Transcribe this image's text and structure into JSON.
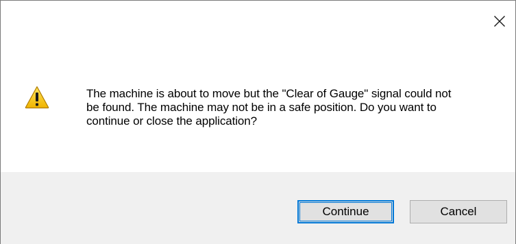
{
  "dialog": {
    "close_icon": "close-icon",
    "warning_icon": "warning-icon",
    "message": "The machine is about to move but the \"Clear of Gauge\" signal could not\nbe found. The machine may not be in a safe position. Do you want to\ncontinue or close the application?",
    "buttons": {
      "continue_label": "Continue",
      "cancel_label": "Cancel"
    }
  },
  "colors": {
    "accent": "#0078d7",
    "footer_bg": "#f0f0f0",
    "warning_yellow": "#f5c400"
  }
}
